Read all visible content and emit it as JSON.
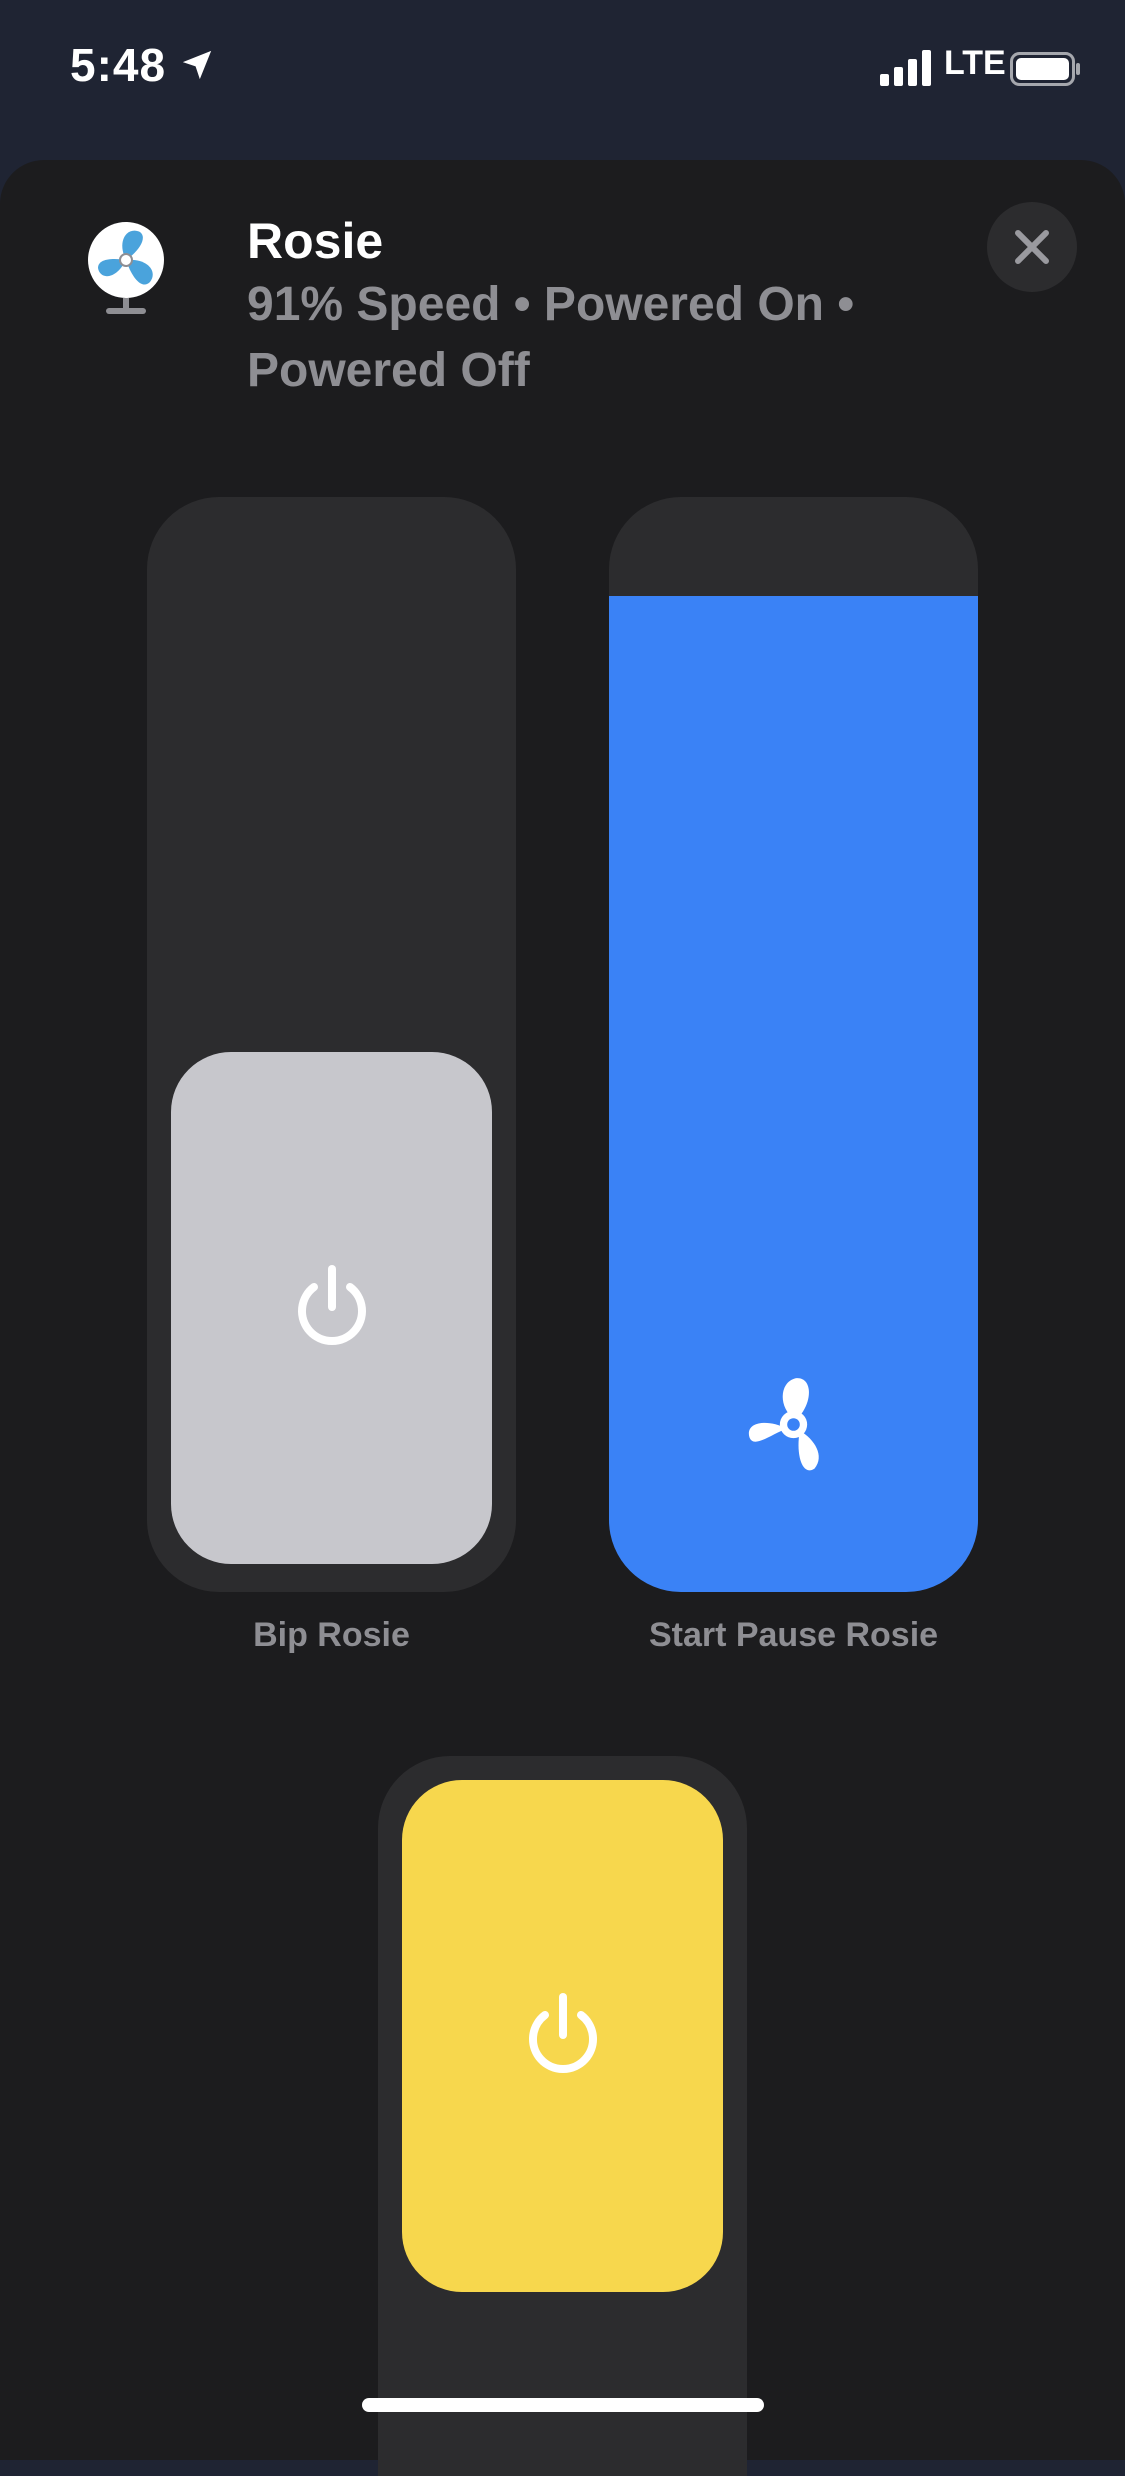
{
  "status_bar": {
    "time": "5:48",
    "network": "LTE",
    "icons": [
      "location-arrow-icon",
      "signal-bars-icon",
      "battery-icon"
    ]
  },
  "accessory": {
    "name": "Rosie",
    "status": "91% Speed • Powered On • Powered Off",
    "icon": "desk-fan-icon"
  },
  "controls": [
    {
      "label": "Bip Rosie",
      "icon": "power-icon",
      "state": "off",
      "knob_color": "#c7c7cc"
    },
    {
      "label": "Start Pause Rosie",
      "icon": "fan-icon",
      "level": 0.91,
      "fill_color": "#3a82f6"
    },
    {
      "label": "",
      "icon": "power-icon",
      "state": "on",
      "knob_color": "#f7d74d"
    }
  ],
  "colors": {
    "background": "#1c1c1e",
    "tile": "#2c2c2e",
    "accent_blue": "#3a82f6",
    "accent_yellow": "#f7d74d",
    "secondary_text": "#8e8e93"
  }
}
